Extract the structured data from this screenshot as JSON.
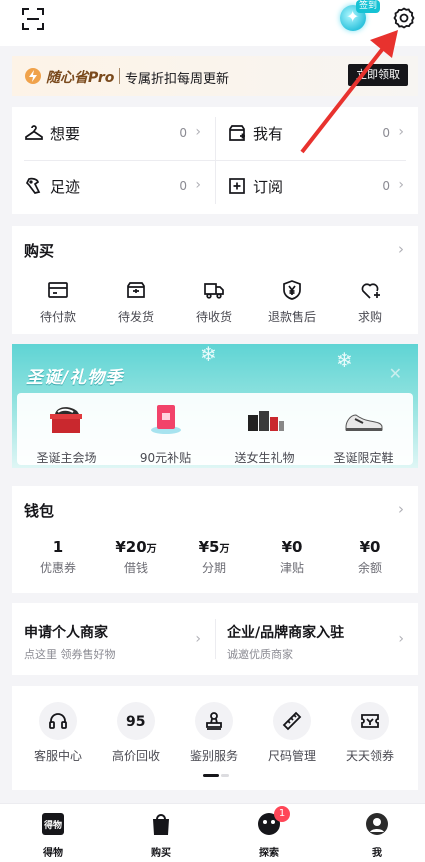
{
  "header": {
    "sign_tag": "签到"
  },
  "promo": {
    "brand": "随心省Pro",
    "text": "专属折扣每周更新",
    "button": "立即领取"
  },
  "quick": [
    {
      "label": "想要",
      "count": "0",
      "icon": "hanger-icon"
    },
    {
      "label": "我有",
      "count": "0",
      "icon": "box-plus-icon"
    },
    {
      "label": "足迹",
      "count": "0",
      "icon": "footprint-icon"
    },
    {
      "label": "订阅",
      "count": "0",
      "icon": "subscribe-plus-icon"
    }
  ],
  "orders": {
    "title": "购买",
    "items": [
      {
        "label": "待付款",
        "icon": "wallet-card-icon"
      },
      {
        "label": "待发货",
        "icon": "package-box-icon"
      },
      {
        "label": "待收货",
        "icon": "delivery-truck-icon"
      },
      {
        "label": "退款售后",
        "icon": "yen-shield-icon"
      },
      {
        "label": "求购",
        "icon": "heart-plus-icon"
      }
    ]
  },
  "christmas": {
    "title": "圣诞/礼物季",
    "items": [
      {
        "label": "圣诞主会场",
        "icon": "sneaker-gift-icon"
      },
      {
        "label": "90元补贴",
        "icon": "red-envelope-icon"
      },
      {
        "label": "送女生礼物",
        "icon": "gift-products-icon"
      },
      {
        "label": "圣诞限定鞋",
        "icon": "sneaker-icon"
      }
    ]
  },
  "wallet": {
    "title": "钱包",
    "items": [
      {
        "value": "1",
        "unit": "",
        "label": "优惠券"
      },
      {
        "value": "¥20",
        "unit": "万",
        "label": "借钱"
      },
      {
        "value": "¥5",
        "unit": "万",
        "label": "分期"
      },
      {
        "value": "¥0",
        "unit": "",
        "label": "津贴"
      },
      {
        "value": "¥0",
        "unit": "",
        "label": "余额"
      }
    ]
  },
  "merchant": [
    {
      "title": "申请个人商家",
      "sub": "点这里 领券售好物"
    },
    {
      "title": "企业/品牌商家入驻",
      "sub": "诚邀优质商家"
    }
  ],
  "services": [
    {
      "label": "客服中心",
      "icon": "headset-icon"
    },
    {
      "label": "高价回收",
      "icon": "recycle-95-icon"
    },
    {
      "label": "鉴别服务",
      "icon": "stamp-icon"
    },
    {
      "label": "尺码管理",
      "icon": "ruler-icon"
    },
    {
      "label": "天天领券",
      "icon": "ticket-icon"
    }
  ],
  "nav": [
    {
      "label": "得物",
      "icon": "dewu-logo-icon"
    },
    {
      "label": "购买",
      "icon": "shopping-bag-icon"
    },
    {
      "label": "探索",
      "icon": "explore-icon",
      "badge": "1"
    },
    {
      "label": "我",
      "icon": "profile-avatar-icon"
    }
  ],
  "colors": {
    "accent": "#16161a",
    "teal": "#5fd4d4",
    "badge": "#ff4657",
    "arrow": "#e8322e"
  }
}
